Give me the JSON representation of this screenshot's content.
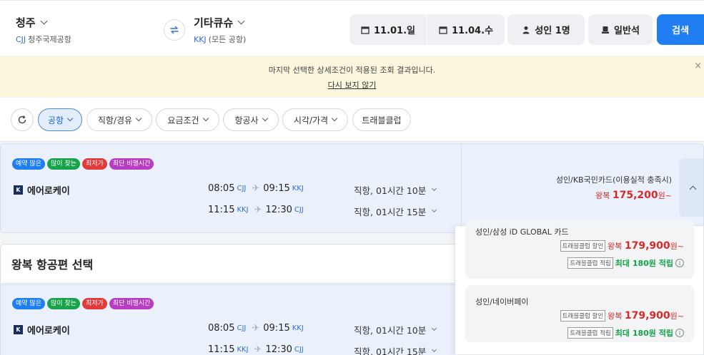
{
  "search": {
    "origin": {
      "name": "청주",
      "code": "CJJ",
      "airport": "청주국제공항"
    },
    "destination": {
      "name": "기타큐슈",
      "code": "KKJ",
      "airport": "(모든 공항)"
    },
    "depart_date": "11.01.일",
    "return_date": "11.04.수",
    "passengers": "성인 1명",
    "cabin": "일반석",
    "search_label": "검색"
  },
  "notice": {
    "message": "마지막 선택한 상세조건이 적용된 조회 결과입니다.",
    "dismiss_link": "다시 보지 않기",
    "close": "×"
  },
  "filters": {
    "items": [
      "공항",
      "직항/경유",
      "요금조건",
      "항공사",
      "시각/가격",
      "트래블클럽"
    ]
  },
  "badges": [
    {
      "label": "예약 많은",
      "color": "#1f7ef2"
    },
    {
      "label": "많이 찾는",
      "color": "#16a34a"
    },
    {
      "label": "최저가",
      "color": "#e23a3a"
    },
    {
      "label": "최단 비행시간",
      "color": "#b83cc4"
    }
  ],
  "flight_card_1": {
    "airline": "에어로케이",
    "logo": "K",
    "outbound": {
      "dep_time": "08:05",
      "dep_ap": "CJJ",
      "arr_time": "09:15",
      "arr_ap": "KKJ",
      "duration": "직항, 01시간 10분"
    },
    "inbound": {
      "dep_time": "11:15",
      "dep_ap": "KKJ",
      "arr_time": "12:30",
      "arr_ap": "CJJ",
      "duration": "직항, 01시간 15분"
    },
    "card_name": "성인/KB국민카드(이용실적 충족시)",
    "price_prefix": "왕복",
    "price": "175,200",
    "price_suffix": "원~"
  },
  "section": {
    "title": "왕복 항공편 선택"
  },
  "flight_card_2": {
    "airline": "에어로케이",
    "logo": "K",
    "outbound": {
      "dep_time": "08:05",
      "dep_ap": "CJJ",
      "arr_time": "09:15",
      "arr_ap": "KKJ",
      "duration": "직항, 01시간 10분"
    },
    "inbound": {
      "dep_time": "11:15",
      "dep_ap": "KKJ",
      "arr_time": "12:30",
      "arr_ap": "CJJ",
      "duration": "직항, 01시간 15분"
    }
  },
  "dropdown": {
    "options": [
      {
        "name": "성인/삼성 iD GLOBAL 카드",
        "discount_tag": "트래블클럽 할인",
        "price_prefix": "왕복",
        "price": "179,900",
        "price_suffix": "원~",
        "points_tag": "트래블클럽 적립",
        "points": "최대 180원 적립"
      },
      {
        "name": "성인/네이버페이",
        "discount_tag": "트래블클럽 할인",
        "price_prefix": "왕복",
        "price": "179,900",
        "price_suffix": "원~",
        "points_tag": "트래블클럽 적립",
        "points": "최대 180원 적립"
      }
    ]
  }
}
